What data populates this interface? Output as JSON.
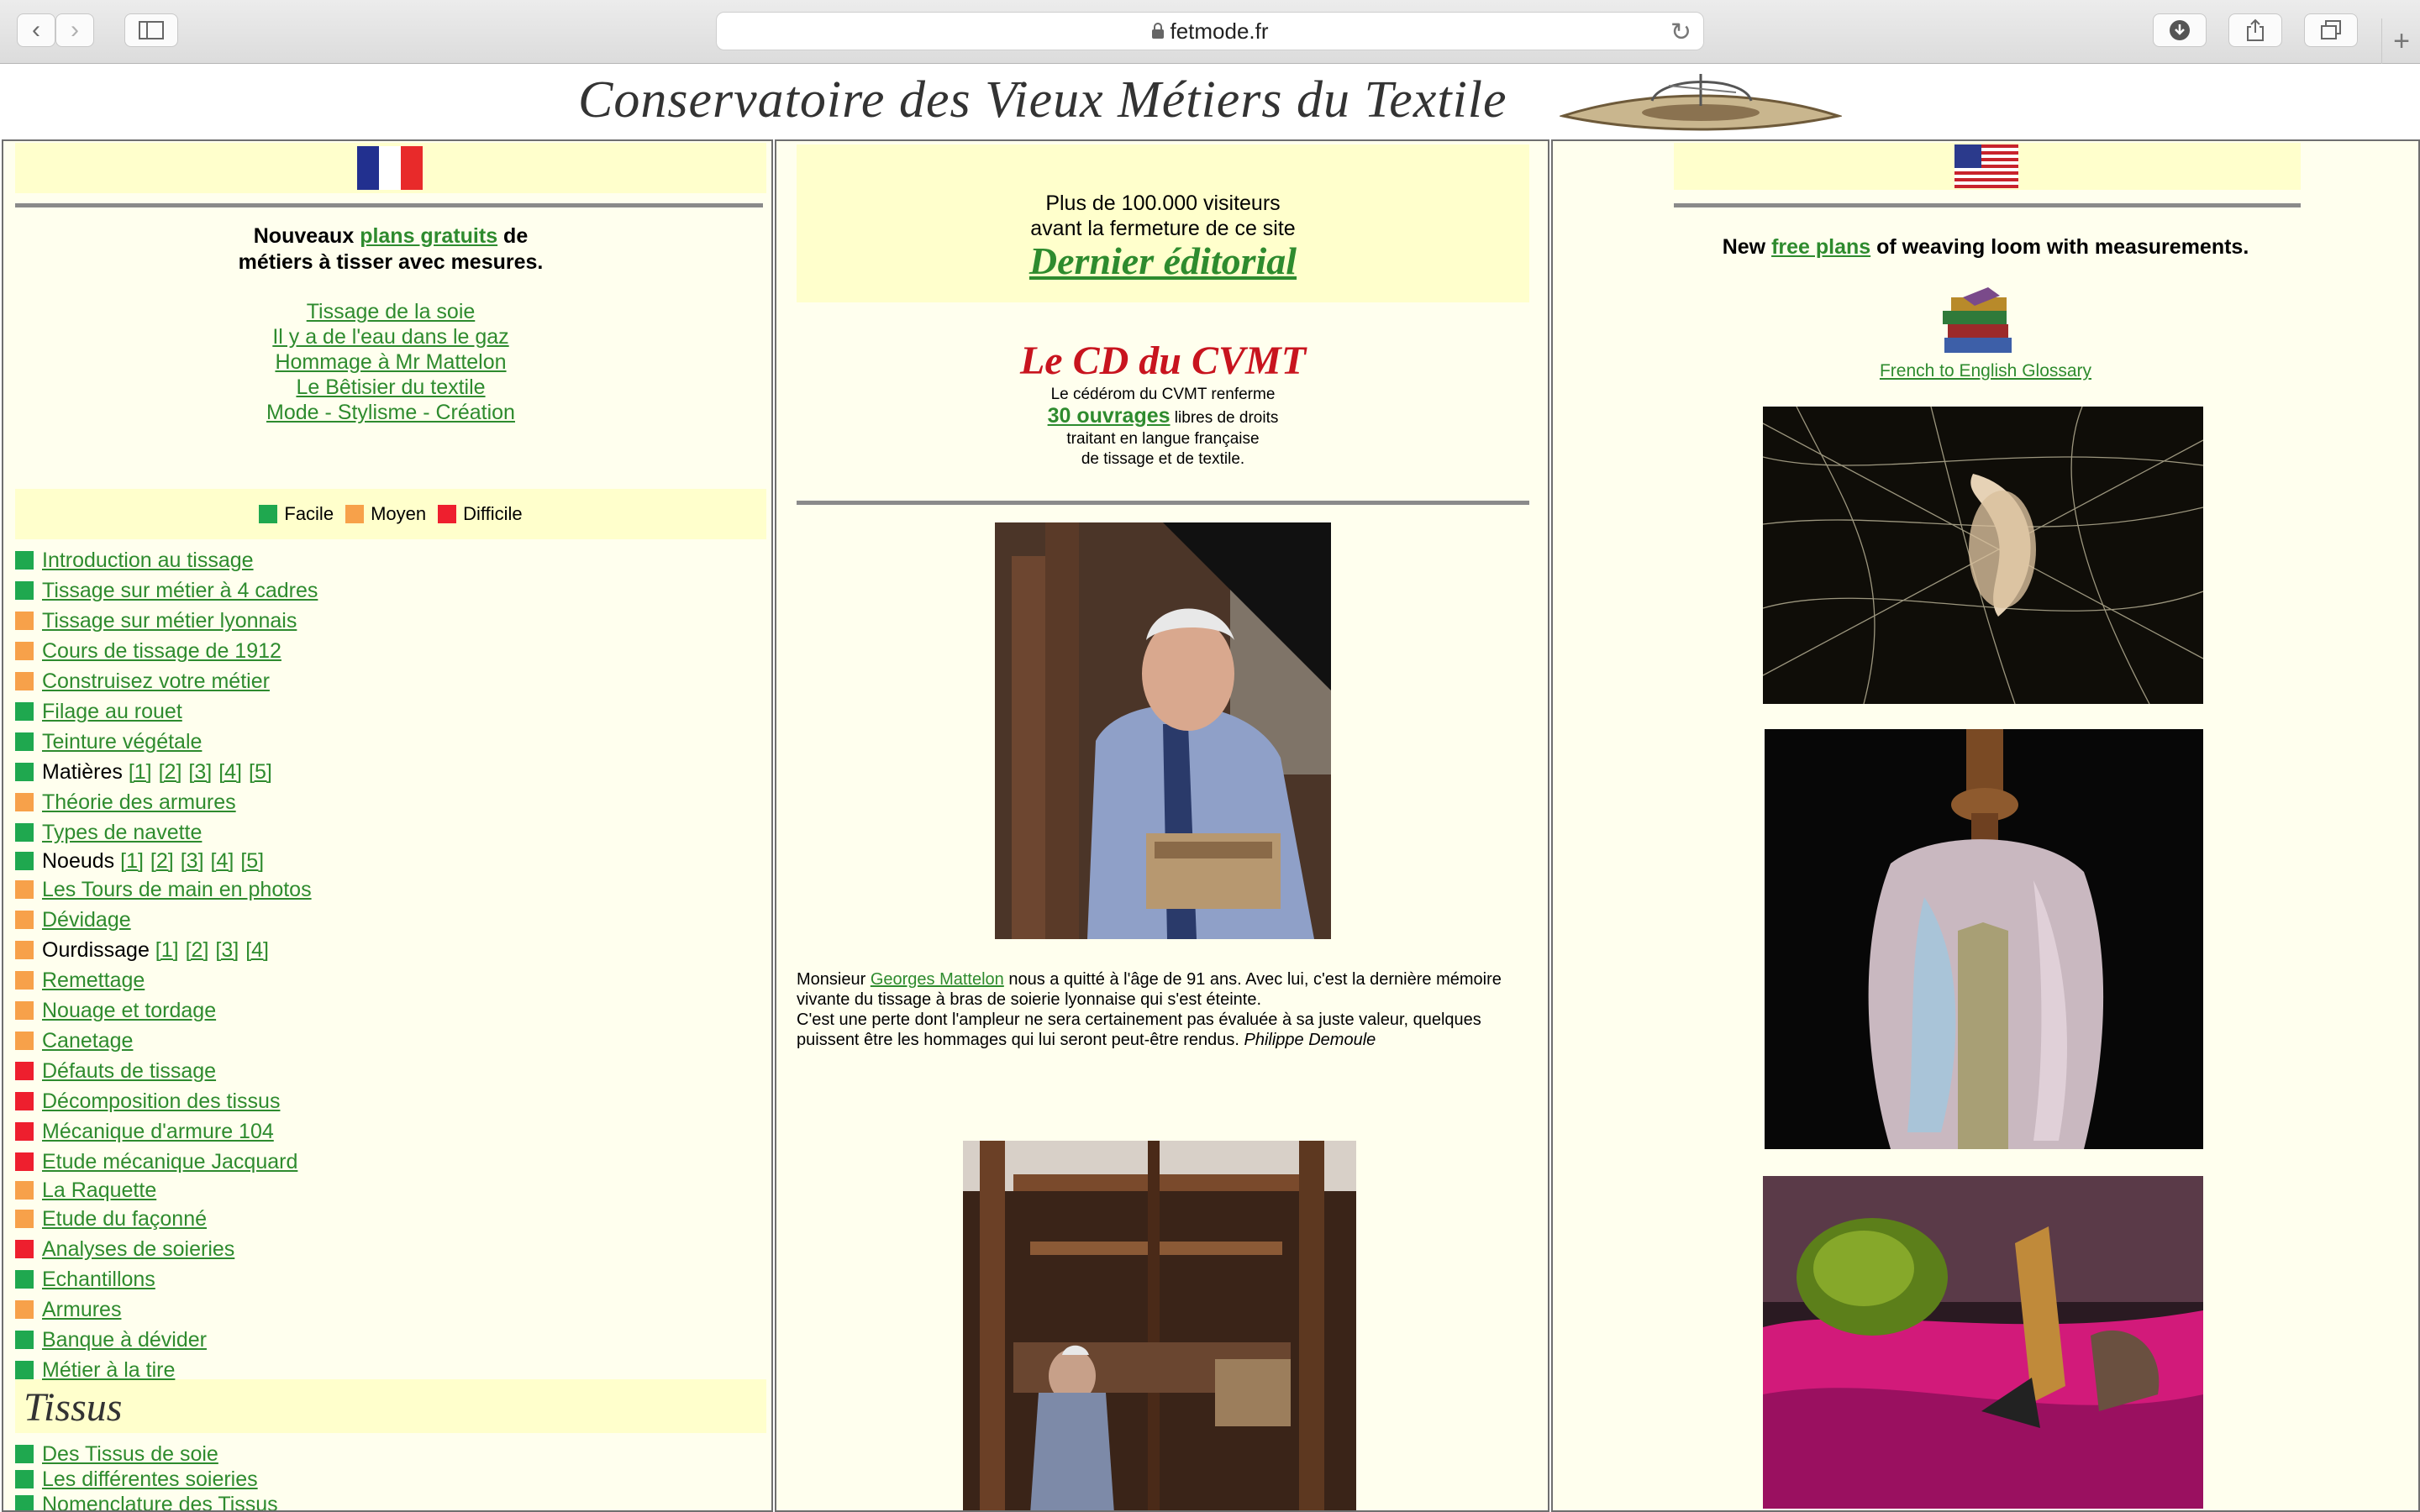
{
  "browser": {
    "url": "fetmode.fr",
    "colors": {
      "chrome": "#e3e3e3"
    }
  },
  "site": {
    "banner_title": "Conservatoire des Vieux Métiers du Textile"
  },
  "left": {
    "intro_bold_1": "Nouveaux ",
    "intro_link": "plans gratuits",
    "intro_bold_2": " de",
    "intro_line2": "métiers à tisser avec mesures.",
    "links": [
      "Tissage de la soie",
      "Il y a de l'eau dans le gaz",
      "Hommage à Mr Mattelon",
      "Le Bêtisier du textile",
      "Mode - Stylisme - Création"
    ],
    "legend": [
      {
        "label": "Facile",
        "color": "#1fa84f"
      },
      {
        "label": "Moyen",
        "color": "#f7a14a"
      },
      {
        "label": "Difficile",
        "color": "#ee1f2e"
      }
    ],
    "menu": [
      {
        "level": "green",
        "label": "Introduction au tissage",
        "linked": true
      },
      {
        "level": "green",
        "label": "Tissage sur métier à 4 cadres",
        "linked": true
      },
      {
        "level": "orange",
        "label": "Tissage sur métier lyonnais",
        "linked": true
      },
      {
        "level": "orange",
        "label": "Cours de tissage de 1912",
        "linked": true
      },
      {
        "level": "orange",
        "label": "Construisez votre métier",
        "linked": true
      },
      {
        "level": "green",
        "label": "Filage au rouet",
        "linked": true
      },
      {
        "level": "green",
        "label": "Teinture végétale",
        "linked": true
      },
      {
        "level": "green",
        "label": "Matières ",
        "linked": false,
        "sublinks": [
          "[1]",
          "[2]",
          "[3]",
          "[4]",
          "[5]"
        ]
      },
      {
        "level": "orange",
        "label": "Théorie des armures",
        "linked": true
      },
      {
        "level": "green",
        "label": "Types de navette",
        "linked": true
      },
      {
        "level": "green",
        "label": "Noeuds ",
        "linked": false,
        "sublinks": [
          "[1]",
          "[2]",
          "[3]",
          "[4]",
          "[5]"
        ]
      },
      {
        "level": "orange",
        "label": "Les Tours de main en photos",
        "linked": true
      },
      {
        "level": "orange",
        "label": "Dévidage",
        "linked": true
      },
      {
        "level": "orange",
        "label": "Ourdissage ",
        "linked": false,
        "sublinks": [
          "[1]",
          "[2]",
          "[3]",
          "[4]"
        ]
      },
      {
        "level": "orange",
        "label": "Remettage",
        "linked": true
      },
      {
        "level": "orange",
        "label": "Nouage et tordage",
        "linked": true
      },
      {
        "level": "orange",
        "label": "Canetage",
        "linked": true
      },
      {
        "level": "red",
        "label": "Défauts de tissage",
        "linked": true
      },
      {
        "level": "red",
        "label": "Décomposition des tissus",
        "linked": true
      },
      {
        "level": "red",
        "label": "Mécanique d'armure 104",
        "linked": true
      },
      {
        "level": "red",
        "label": "Etude mécanique Jacquard",
        "linked": true
      },
      {
        "level": "orange",
        "label": "La Raquette",
        "linked": true
      },
      {
        "level": "orange",
        "label": "Etude du façonné",
        "linked": true
      },
      {
        "level": "red",
        "label": "Analyses de soieries",
        "linked": true
      },
      {
        "level": "green",
        "label": "Echantillons",
        "linked": true
      },
      {
        "level": "orange",
        "label": "Armures",
        "linked": true
      },
      {
        "level": "green",
        "label": "Banque à dévider",
        "linked": true
      },
      {
        "level": "green",
        "label": "Métier à la tire",
        "linked": true
      }
    ],
    "tissus_heading": "Tissus",
    "tissus_menu": [
      {
        "level": "green",
        "label": "Des Tissus de soie"
      },
      {
        "level": "green",
        "label": "Les différentes soieries"
      },
      {
        "level": "green",
        "label": "Nomenclature des Tissus"
      }
    ]
  },
  "middle": {
    "visitors_line1": "Plus de 100.000 visiteurs",
    "visitors_line2": "avant la fermeture de ce site",
    "editorial_link": "Dernier éditorial",
    "cd_title": "Le CD du CVMT",
    "cd_line1": "Le cédérom du CVMT renferme",
    "cd_link": "30 ouvrages",
    "cd_line2_rest": " libres de droits",
    "cd_line3": "traitant en langue française",
    "cd_line4": "de tissage et de textile.",
    "caption_prefix": "Monsieur ",
    "caption_link": "Georges Mattelon",
    "caption_text1": " nous a quitté à l'âge de 91 ans. Avec lui, c'est la dernière mémoire vivante du tissage à bras de soierie lyonnaise qui s'est éteinte.",
    "caption_text2": "C'est une perte dont l'ampleur ne sera certainement pas évaluée à sa juste valeur, quelques puissent être les hommages qui lui seront peut-être rendus. ",
    "caption_author": "Philippe Demoule"
  },
  "right": {
    "intro_1": "New ",
    "intro_link": "free plans",
    "intro_2": " of weaving loom with measurements.",
    "glossary_link": "French to English Glossary"
  }
}
